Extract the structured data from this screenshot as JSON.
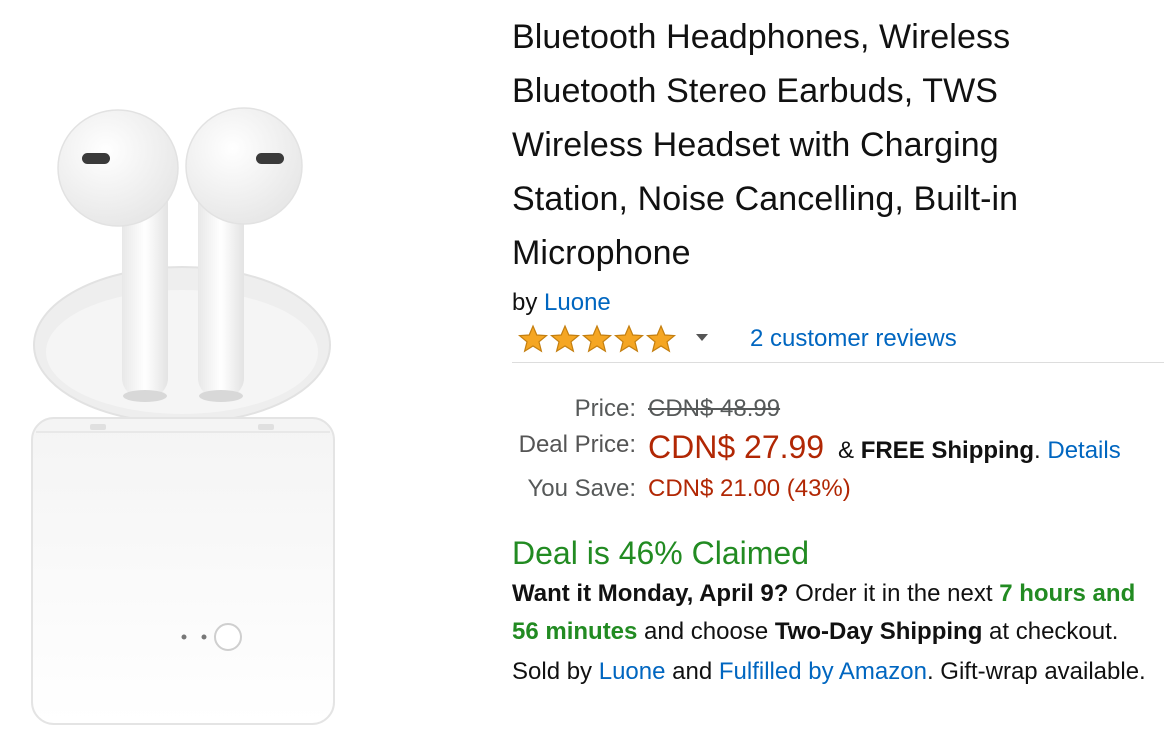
{
  "product": {
    "title": "Bluetooth Headphones, Wireless Bluetooth Stereo Earbuds, TWS Wireless Headset with Charging Station, Noise Cancelling, Built-in Microphone",
    "title_lines": [
      "Bluetooth Headphones, Wireless",
      "Bluetooth Stereo Earbuds, TWS",
      "Wireless Headset with Charging",
      "Station, Noise Cancelling, Built-in",
      "Microphone"
    ],
    "by_prefix": "by",
    "brand": "Luone",
    "image_icon": "earbuds-with-charging-case-image"
  },
  "rating": {
    "stars": 5,
    "max_stars": 5,
    "star_color": "#f5a623",
    "reviews_text": "2 customer reviews"
  },
  "pricing": {
    "price_label": "Price:",
    "list_price": "CDN$ 48.99",
    "deal_label": "Deal Price:",
    "deal_price": "CDN$ 27.99",
    "shipping_prefix": "&",
    "free_shipping": "FREE Shipping",
    "shipping_period": ".",
    "details_link": "Details",
    "save_label": "You Save:",
    "save_value": "CDN$ 21.00 (43%)",
    "price_color": "#b12704"
  },
  "deal": {
    "claimed_text": "Deal is 46% Claimed",
    "claimed_color": "#228b22"
  },
  "delivery": {
    "want_it": "Want it Monday, April 9?",
    "order_text": " Order it in the next ",
    "countdown": "7 hours and 56 minutes",
    "choose_text": " and choose ",
    "shipping_method": "Two-Day Shipping",
    "at_checkout": " at checkout."
  },
  "seller": {
    "sold_by_prefix": "Sold by ",
    "seller_name": "Luone",
    "and_text": " and ",
    "fulfilled_link": "Fulfilled by Amazon",
    "gift_text": ". Gift-wrap available."
  },
  "colors": {
    "link": "#0066c0",
    "text": "#111111",
    "muted": "#565959"
  }
}
